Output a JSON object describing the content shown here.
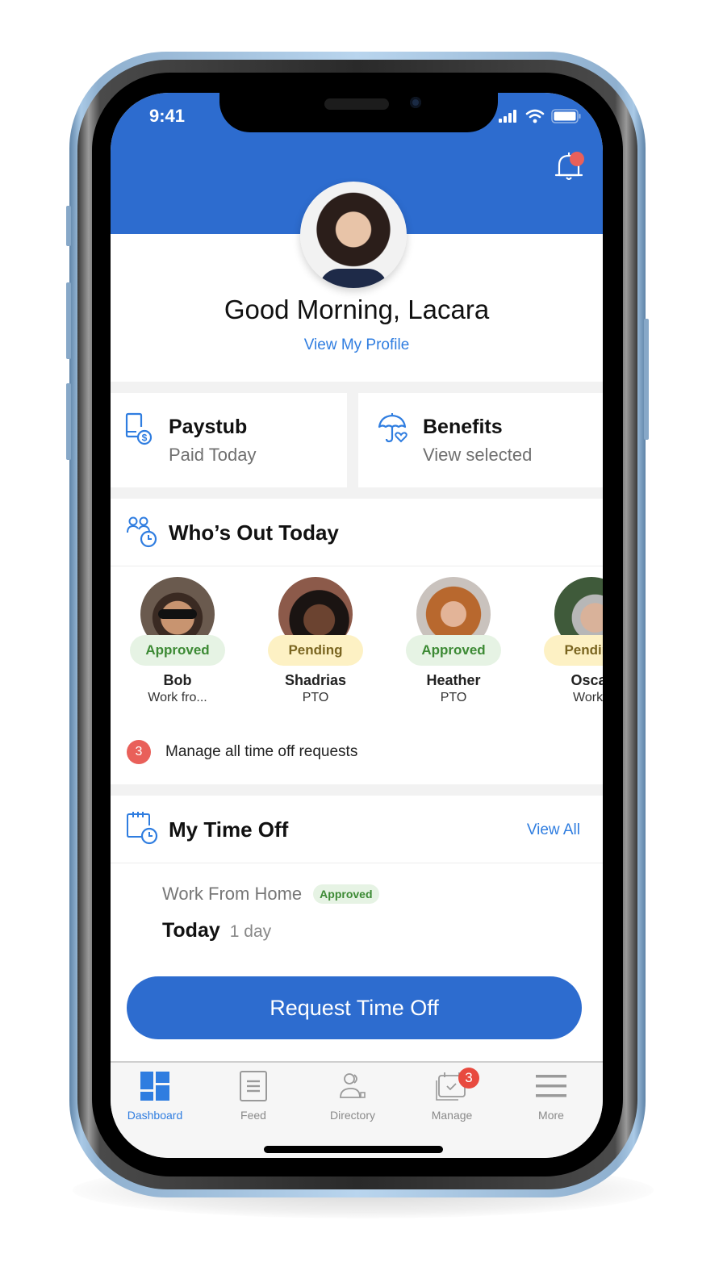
{
  "status_bar": {
    "time": "9:41"
  },
  "header": {
    "greeting": "Good Morning, Lacara",
    "view_profile_link": "View My Profile",
    "notification_dot": true
  },
  "cards": {
    "paystub": {
      "title": "Paystub",
      "subtitle": "Paid Today",
      "icon": "paystub-phone-dollar-icon"
    },
    "benefits": {
      "title": "Benefits",
      "subtitle": "View selected",
      "icon": "umbrella-heart-icon"
    }
  },
  "whos_out": {
    "title": "Who’s Out Today",
    "icon": "people-clock-icon",
    "people": [
      {
        "name": "Bob",
        "type": "Work fro...",
        "status": "Approved"
      },
      {
        "name": "Shadrias",
        "type": "PTO",
        "status": "Pending"
      },
      {
        "name": "Heather",
        "type": "PTO",
        "status": "Approved"
      },
      {
        "name": "Oscar",
        "type": "Work f",
        "status": "Pending"
      }
    ],
    "manage": {
      "count": "3",
      "label": "Manage all time off requests"
    }
  },
  "my_time_off": {
    "title": "My Time Off",
    "icon": "calendar-clock-icon",
    "view_all": "View All",
    "entry": {
      "type": "Work From Home",
      "status": "Approved",
      "when": "Today",
      "duration": "1 day"
    },
    "request_button": "Request Time Off"
  },
  "tabbar": {
    "items": [
      {
        "label": "Dashboard",
        "icon": "dashboard-icon",
        "active": true
      },
      {
        "label": "Feed",
        "icon": "feed-icon",
        "active": false
      },
      {
        "label": "Directory",
        "icon": "directory-icon",
        "active": false
      },
      {
        "label": "Manage",
        "icon": "manage-calendar-icon",
        "active": false,
        "badge": "3"
      },
      {
        "label": "More",
        "icon": "menu-icon",
        "active": false
      }
    ]
  },
  "colors": {
    "brand_blue": "#2d6ccf",
    "link_blue": "#2f7de0",
    "alert_red": "#e9605a",
    "approved_bg": "#e6f3e4",
    "approved_text": "#3c8a34",
    "pending_bg": "#fdf1c4",
    "pending_text": "#7a6520"
  }
}
